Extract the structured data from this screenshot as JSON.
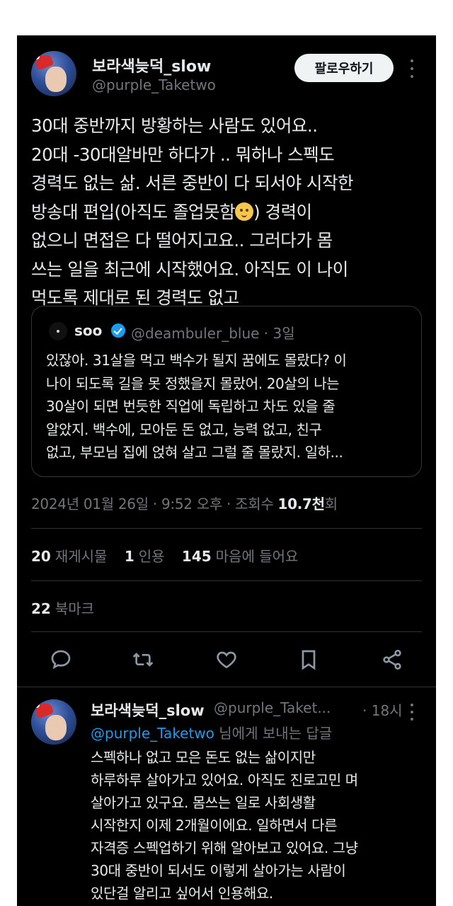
{
  "post": {
    "author_name": "보라색늦덕_slow",
    "author_handle": "@purple_Taketwo",
    "follow_label": "팔로우하기",
    "lines_before_emoji": [
      "30대 중반까지 방황하는 사람도 있어요..",
      "20대 -30대알바만 하다가 .. 뭐하나 스펙도",
      "경력도 없는 삶. 서른 중반이 다 되서야 시작한"
    ],
    "emoji_line_start": "방송대 편입(아직도 졸업못함",
    "emoji_line_end": ") 경력이",
    "emoji_name": "hugging-face-emoji",
    "lines_after_emoji": [
      "없으니 면접은 다 떨어지고요.. 그러다가 몸",
      "쓰는 일을 최근에 시작했어요. 아직도 이 나이",
      "먹도록 제대로 된 경력도 없고"
    ]
  },
  "quote": {
    "name": "soo",
    "handle_time": "@deambuler_blue · 3일",
    "lines": [
      "있잖아. 31살을 먹고 백수가 될지 꿈에도 몰랐다? 이",
      "나이 되도록 길을 못 정했을지 몰랐어. 20살의 나는",
      "30살이 되면 번듯한 직업에 독립하고 차도 있을 줄",
      "알았지. 백수에, 모아둔 돈 없고, 능력 없고, 친구",
      "없고, 부모님 집에 얹혀 살고 그럴 줄 몰랐지. 일하..."
    ]
  },
  "meta": {
    "datetime": "2024년 01월 26일 · 9:52 오후 · 조회수 ",
    "views": "10.7천",
    "views_suffix": "회"
  },
  "stats": {
    "reposts_count": "20",
    "reposts_label": "재게시물",
    "quotes_count": "1",
    "quotes_label": "인용",
    "likes_count": "145",
    "likes_label": "마음에 들어요",
    "bookmarks_count": "22",
    "bookmarks_label": "북마크"
  },
  "actions": [
    "reply-icon",
    "repost-icon",
    "like-icon",
    "bookmark-icon",
    "share-icon"
  ],
  "reply": {
    "author_name": "보라색늦덕_slow",
    "author_handle": "@purple_Taket...",
    "time": "· 18시",
    "mention": "@purple_Taketwo",
    "replying_suffix": " 님에게 보내는 답글",
    "lines": [
      "스펙하나 없고 모은 돈도 없는 삶이지만",
      "하루하루 살아가고 있어요. 아직도 진로고민 며",
      "살아가고 있구요. 몸쓰는 일로 사회생활",
      "시작한지 이제 2개월이에요. 일하면서 다른",
      "자격증 스펙업하기 위해 알아보고 있어요. 그냥",
      "30대 중반이 되서도 이렇게 살아가는 사람이",
      "있단걸 알리고 싶어서 인용해요."
    ]
  },
  "colors": {
    "background": "#000000",
    "text": "#e7e9ea",
    "muted": "#71767b",
    "accent": "#1d9bf0",
    "border": "#2f3336"
  }
}
